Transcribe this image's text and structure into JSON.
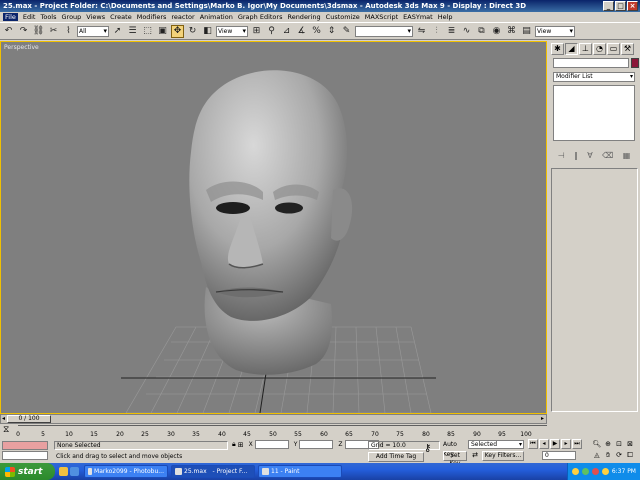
{
  "window": {
    "title": "25.max     - Project Folder: C:\\Documents and Settings\\Marko B. Igor\\My Documents\\3dsmax     - Autodesk 3ds Max 9     - Display : Direct 3D",
    "min": "_",
    "max": "□",
    "close": "×"
  },
  "menu": [
    "File",
    "Edit",
    "Tools",
    "Group",
    "Views",
    "Create",
    "Modifiers",
    "reactor",
    "Animation",
    "Graph Editors",
    "Rendering",
    "Customize",
    "MAXScript",
    "EASYmat",
    "Help"
  ],
  "toolbar": {
    "selection_filter": "All",
    "ref_coord": "View",
    "named_selection": "",
    "render_type": "View"
  },
  "viewport": {
    "label": "Perspective",
    "border_color": "#f0c000"
  },
  "command_panel": {
    "modifier_list": "Modifier List",
    "object_color": "#8b1538"
  },
  "timeline": {
    "slider_label": "0 / 100",
    "ticks": [
      "0",
      "5",
      "10",
      "15",
      "20",
      "25",
      "30",
      "35",
      "40",
      "45",
      "50",
      "55",
      "60",
      "65",
      "70",
      "75",
      "80",
      "85",
      "90",
      "95",
      "100"
    ]
  },
  "status": {
    "selection": "None Selected",
    "prompt": "Click and drag to select and move objects",
    "x_label": "X",
    "y_label": "Y",
    "z_label": "Z",
    "grid": "Grid = 10.0",
    "add_time_tag": "Add Time Tag",
    "auto_key": "Auto Key",
    "set_key": "Set Key",
    "key_mode": "Selected",
    "key_filters": "Key Filters...",
    "current_frame": "0"
  },
  "taskbar": {
    "start": "start",
    "tasks": [
      "Marko2099 - Photobu...",
      "25.max",
      "- Project F...",
      "11 - Paint"
    ],
    "clock": "6:37 PM"
  }
}
